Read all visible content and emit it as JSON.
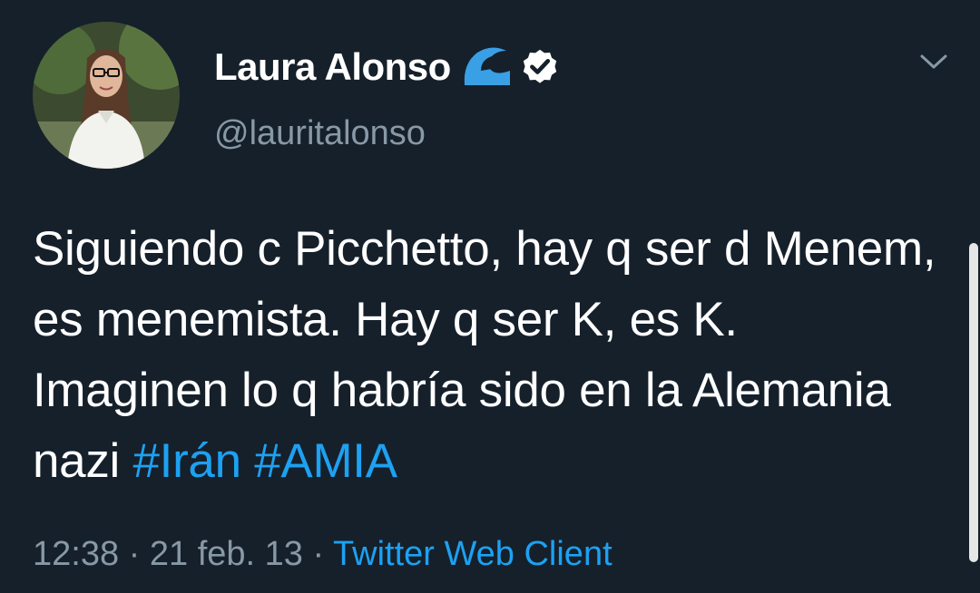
{
  "author": {
    "display_name": "Laura Alonso",
    "handle": "@lauritalonso",
    "badge_icon": "wave-icon",
    "verified_icon": "verified-badge-icon"
  },
  "tweet": {
    "text_plain": "Siguiendo c Picchetto, hay q ser d Menem, es menemista. Hay q ser K, es K. Imaginen lo q habría sido en la Alemania nazi",
    "hashtags": [
      "#Irán",
      "#AMIA"
    ]
  },
  "meta": {
    "time": "12:38",
    "separator1": " · ",
    "date": "21 feb. 13",
    "separator2": " · ",
    "source": "Twitter Web Client"
  },
  "colors": {
    "background": "#15202b",
    "text": "#ffffff",
    "secondary": "#8899a6",
    "link": "#1da1f2"
  },
  "icons": {
    "menu": "chevron-down-icon"
  }
}
